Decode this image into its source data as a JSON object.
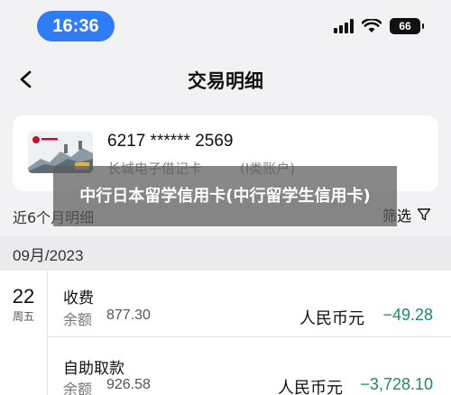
{
  "status_bar": {
    "time": "16:36",
    "battery": "66"
  },
  "nav": {
    "title": "交易明细"
  },
  "card": {
    "number": "6217 ****** 2569",
    "name": "长城电子借记卡",
    "type": "(I类账户)"
  },
  "filter": {
    "period_label": "近6个月明细",
    "filter_label": "筛选"
  },
  "month_header": "09月/2023",
  "date_group": {
    "day": "22",
    "weekday": "周五"
  },
  "transactions": [
    {
      "title": "收费",
      "balance_label": "余额",
      "balance": "877.30",
      "currency": "人民币元",
      "amount": "−49.28"
    },
    {
      "title": "自助取款",
      "balance_label": "余额",
      "balance": "926.58",
      "currency": "人民币元",
      "amount": "−3,728.10"
    }
  ],
  "overlay": {
    "text": "中行日本留学信用卡(中行留学生信用卡)"
  },
  "colors": {
    "time_pill": "#2f7cf6",
    "amount": "#1f8a70"
  },
  "icons": [
    "signal-icon",
    "wifi-icon",
    "battery-icon",
    "back-arrow-icon",
    "filter-icon",
    "card-image"
  ]
}
